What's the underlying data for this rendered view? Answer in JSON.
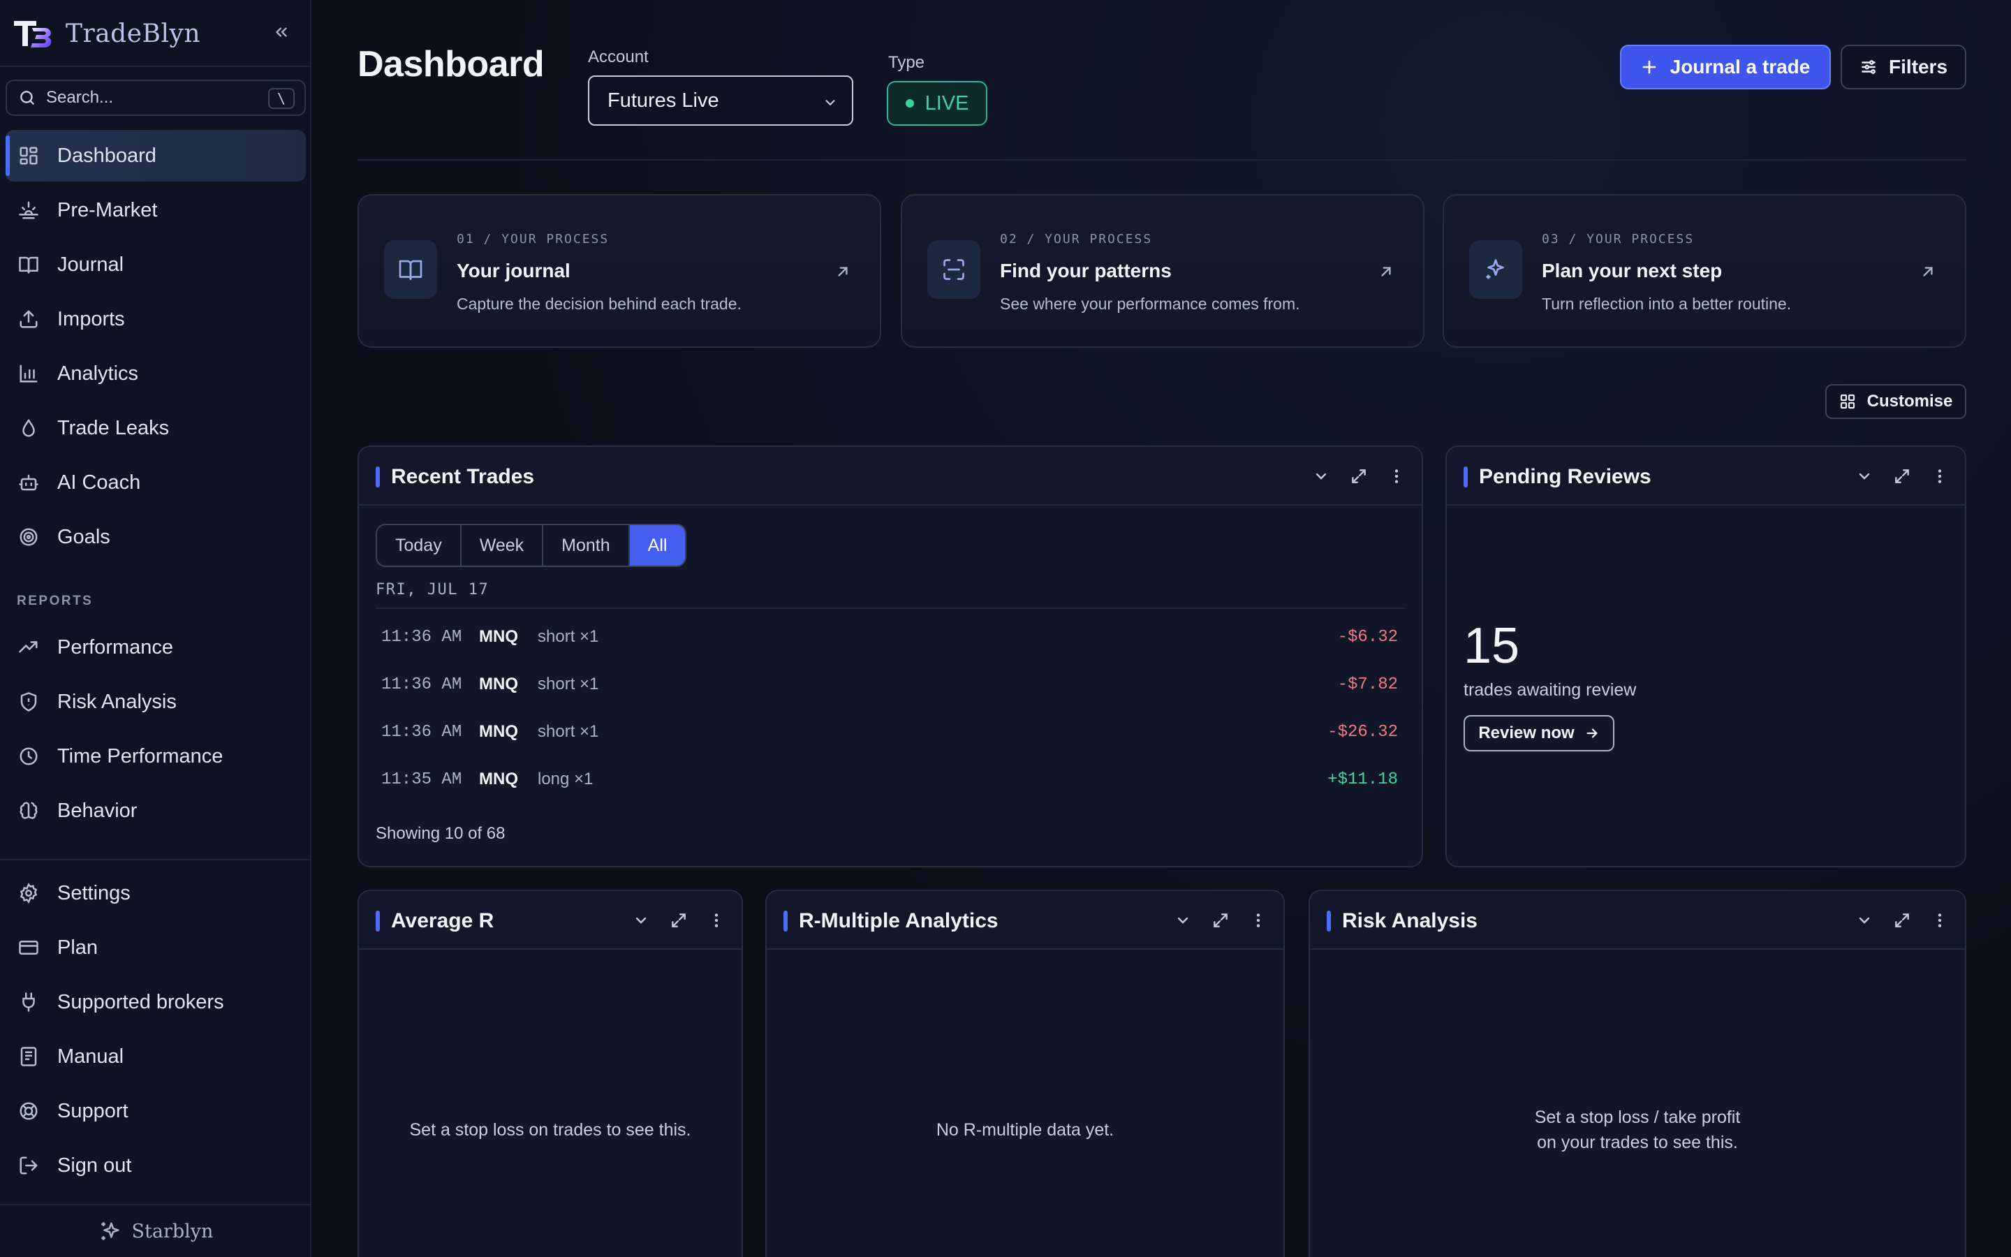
{
  "app": {
    "name": "TradeBlyn",
    "footer_brand": "Starblyn"
  },
  "sidebar": {
    "search_placeholder": "Search...",
    "search_shortcut": "\\",
    "items": [
      {
        "label": "Dashboard",
        "icon": "grid-icon",
        "active": true
      },
      {
        "label": "Pre-Market",
        "icon": "sunrise-icon"
      },
      {
        "label": "Journal",
        "icon": "book-icon"
      },
      {
        "label": "Imports",
        "icon": "upload-icon"
      },
      {
        "label": "Analytics",
        "icon": "bar-chart-icon"
      },
      {
        "label": "Trade Leaks",
        "icon": "droplet-icon"
      },
      {
        "label": "AI Coach",
        "icon": "bot-icon"
      },
      {
        "label": "Goals",
        "icon": "target-icon"
      }
    ],
    "reports_label": "REPORTS",
    "reports": [
      {
        "label": "Performance",
        "icon": "trend-up-icon"
      },
      {
        "label": "Risk Analysis",
        "icon": "shield-icon"
      },
      {
        "label": "Time Performance",
        "icon": "clock-icon"
      },
      {
        "label": "Behavior",
        "icon": "brain-icon"
      }
    ],
    "bottom": [
      {
        "label": "Settings",
        "icon": "gear-icon"
      },
      {
        "label": "Plan",
        "icon": "credit-card-icon"
      },
      {
        "label": "Supported brokers",
        "icon": "plug-icon"
      },
      {
        "label": "Manual",
        "icon": "manual-icon"
      },
      {
        "label": "Support",
        "icon": "lifebuoy-icon"
      },
      {
        "label": "Sign out",
        "icon": "sign-out-icon"
      }
    ]
  },
  "header": {
    "title": "Dashboard",
    "account_label": "Account",
    "account_value": "Futures Live",
    "type_label": "Type",
    "type_value": "LIVE",
    "journal_button": "Journal a trade",
    "filters_button": "Filters"
  },
  "process": [
    {
      "kicker": "01 / YOUR PROCESS",
      "title": "Your journal",
      "desc": "Capture the decision behind each trade.",
      "icon": "book-open-icon"
    },
    {
      "kicker": "02 / YOUR PROCESS",
      "title": "Find your patterns",
      "desc": "See where your performance comes from.",
      "icon": "scan-icon"
    },
    {
      "kicker": "03 / YOUR PROCESS",
      "title": "Plan your next step",
      "desc": "Turn reflection into a better routine.",
      "icon": "sparkle-icon"
    }
  ],
  "customise_label": "Customise",
  "recent_trades": {
    "title": "Recent Trades",
    "ranges": [
      "Today",
      "Week",
      "Month",
      "All"
    ],
    "selected_range": "All",
    "date": "FRI, JUL 17",
    "rows": [
      {
        "time": "11:36 AM",
        "symbol": "MNQ",
        "side": "short ×1",
        "pnl": "-$6.32",
        "dir": "neg"
      },
      {
        "time": "11:36 AM",
        "symbol": "MNQ",
        "side": "short ×1",
        "pnl": "-$7.82",
        "dir": "neg"
      },
      {
        "time": "11:36 AM",
        "symbol": "MNQ",
        "side": "short ×1",
        "pnl": "-$26.32",
        "dir": "neg"
      },
      {
        "time": "11:35 AM",
        "symbol": "MNQ",
        "side": "long ×1",
        "pnl": "+$11.18",
        "dir": "pos"
      }
    ],
    "showing": "Showing 10 of 68"
  },
  "pending_reviews": {
    "title": "Pending Reviews",
    "count": "15",
    "label": "trades awaiting review",
    "button": "Review now"
  },
  "average_r": {
    "title": "Average R",
    "message": "Set a stop loss on trades to see this."
  },
  "r_multiple": {
    "title": "R-Multiple Analytics",
    "message": "No R-multiple data yet."
  },
  "risk_analysis": {
    "title": "Risk Analysis",
    "message_line1": "Set a stop loss / take profit",
    "message_line2": "on your trades to see this."
  },
  "colors": {
    "accent": "#4d6dff",
    "primary_button": "#3e55f0",
    "live": "#34d399",
    "loss": "#f2768a",
    "gain": "#3ed6a0"
  }
}
